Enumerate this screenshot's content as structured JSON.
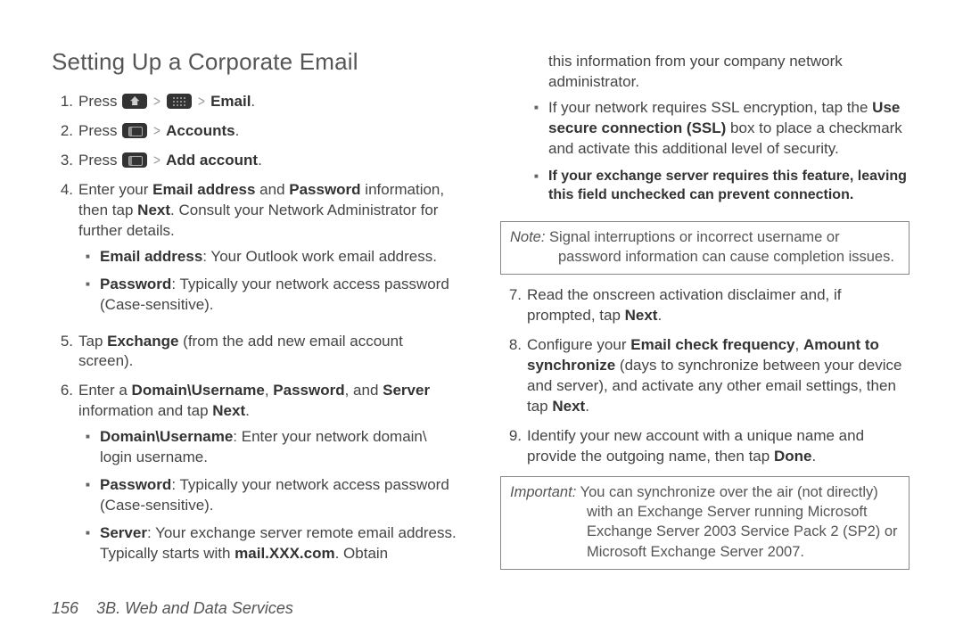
{
  "title": "Setting Up a Corporate Email",
  "left": {
    "s1": {
      "num": "1.",
      "press": "Press ",
      "after": "Email",
      "period": "."
    },
    "s2": {
      "num": "2.",
      "press": "Press ",
      "after": "Accounts",
      "period": "."
    },
    "s3": {
      "num": "3.",
      "press": "Press ",
      "after": "Add account",
      "period": "."
    },
    "s4": {
      "num": "4.",
      "a": "Enter your ",
      "b": "Email address",
      "c": " and ",
      "d": "Password",
      "e": " information, then tap ",
      "f": "Next",
      "g": ". Consult your Network Administrator for further details."
    },
    "s4sub1": {
      "a": "Email address",
      "b": ": Your Outlook work email address."
    },
    "s4sub2": {
      "a": "Password",
      "b": ": Typically your network access password (Case-sensitive)."
    },
    "s5": {
      "num": "5.",
      "a": "Tap ",
      "b": "Exchange",
      "c": " (from the add new email account screen)."
    },
    "s6": {
      "num": "6.",
      "a": "Enter a ",
      "b": "Domain\\Username",
      "c": ", ",
      "d": "Password",
      "e": ", and ",
      "f": "Server",
      "g": " information and tap ",
      "h": "Next",
      "i": "."
    },
    "s6sub1": {
      "a": "Domain\\Username",
      "b": ": Enter your network domain\\ login username."
    },
    "s6sub2": {
      "a": "Password",
      "b": ": Typically your network access password (Case-sensitive)."
    },
    "s6sub3": {
      "a": "Server",
      "b": ": Your exchange server remote email address. Typically starts with ",
      "c": "mail.XXX.com",
      "d": ". Obtain"
    }
  },
  "right": {
    "cont6c": "this information from your company network administrator.",
    "ssl": {
      "a": "If your network requires SSL encryption, tap the ",
      "b": "Use secure connection (SSL)",
      "c": " box to place a checkmark and activate this additional level of security."
    },
    "sslnote": "If your exchange server requires this feature, leaving this field unchecked can prevent connection.",
    "note1": {
      "lbl": "Note:",
      "txt": " Signal interruptions or incorrect username or password information can cause completion issues."
    },
    "s7": {
      "num": "7.",
      "a": "Read the onscreen activation disclaimer and, if prompted, tap ",
      "b": "Next",
      "c": "."
    },
    "s8": {
      "num": "8.",
      "a": "Configure your ",
      "b": "Email check frequency",
      "c": ", ",
      "d": "Amount to synchronize",
      "e": " (days to synchronize between your device and server), and activate any other email settings, then tap ",
      "f": "Next",
      "g": "."
    },
    "s9": {
      "num": "9.",
      "a": "Identify your new account with a unique name and provide the outgoing name, then tap ",
      "b": "Done",
      "c": "."
    },
    "note2": {
      "lbl": "Important:",
      "txt": " You can synchronize over the air (not directly) with an Exchange Server running Microsoft Exchange Server 2003 Service Pack 2 (SP2) or Microsoft Exchange Server 2007."
    }
  },
  "footer": {
    "page": "156",
    "section": "3B. Web and Data Services"
  },
  "gt": ">"
}
